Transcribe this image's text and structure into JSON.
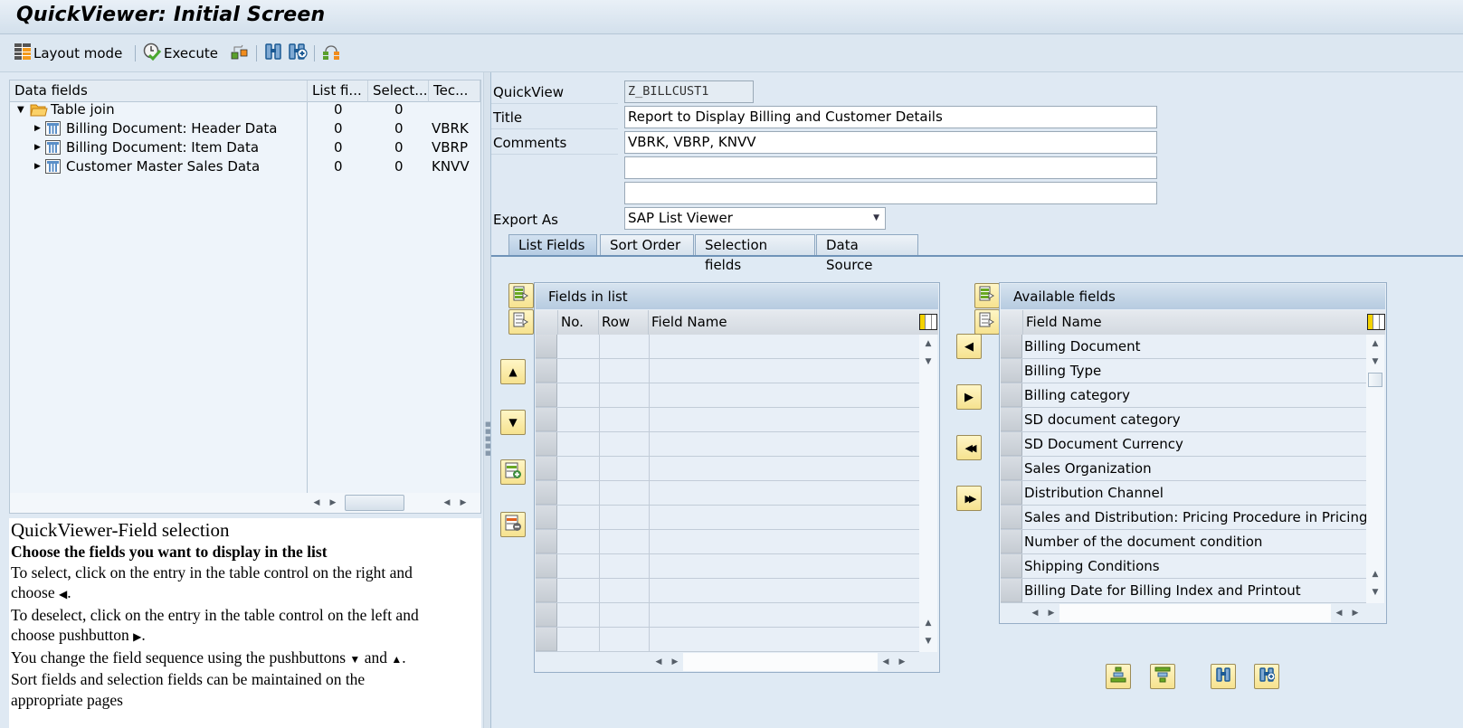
{
  "window": {
    "title": "QuickViewer: Initial Screen"
  },
  "toolbar": {
    "layout_mode": "Layout mode",
    "execute": "Execute",
    "icons": [
      "layout-grid-icon",
      "execute-clock-check-icon",
      "transport-icon",
      "find-icon",
      "find-next-icon",
      "hierarchy-icon"
    ]
  },
  "tree": {
    "headers": [
      "Data fields",
      "List fi...",
      "Select...",
      "Tec..."
    ],
    "rows": [
      {
        "label": "Table join",
        "list": "0",
        "select": "0",
        "tech": "",
        "level": 0,
        "expanded": true,
        "icon": "folder-icon"
      },
      {
        "label": "Billing Document: Header Data",
        "list": "0",
        "select": "0",
        "tech": "VBRK",
        "level": 1,
        "expanded": false,
        "icon": "table-icon"
      },
      {
        "label": "Billing Document: Item Data",
        "list": "0",
        "select": "0",
        "tech": "VBRP",
        "level": 1,
        "expanded": false,
        "icon": "table-icon"
      },
      {
        "label": "Customer Master Sales Data",
        "list": "0",
        "select": "0",
        "tech": "KNVV",
        "level": 1,
        "expanded": false,
        "icon": "table-icon"
      }
    ]
  },
  "help": {
    "title": "QuickViewer-Field selection",
    "subtitle": "Choose the fields you want to display in the list",
    "lines": [
      "To select, click on the entry in the table control on the right and",
      "choose",
      "To deselect, click on the entry in the table control on the left and",
      "choose pushbutton",
      "You change the field sequence using the pushbuttons",
      "and",
      "Sort fields and selection fields can be maintained on the",
      "appropriate pages"
    ]
  },
  "form": {
    "quickview_label": "QuickView",
    "quickview_value": "Z_BILLCUST1",
    "title_label": "Title",
    "title_value": "Report to Display Billing and Customer Details",
    "comments_label": "Comments",
    "comments_value": "VBRK, VBRP, KNVV",
    "comments_line2": "",
    "comments_line3": "",
    "export_label": "Export As",
    "export_value": "SAP List Viewer"
  },
  "tabs": [
    {
      "label": "List Fields",
      "active": true
    },
    {
      "label": "Sort Order",
      "active": false
    },
    {
      "label": "Selection fields",
      "active": false
    },
    {
      "label": "Data Source",
      "active": false
    }
  ],
  "fields_in_list": {
    "title": "Fields in list",
    "headers": [
      "No.",
      "Row",
      "Field Name"
    ],
    "rows": [
      "",
      "",
      "",
      "",
      "",
      "",
      "",
      "",
      "",
      "",
      "",
      "",
      ""
    ]
  },
  "available_fields": {
    "title": "Available fields",
    "header": "Field Name",
    "rows": [
      "Billing Document",
      "Billing Type",
      "Billing category",
      "SD document category",
      "SD Document Currency",
      "Sales Organization",
      "Distribution Channel",
      "Sales and Distribution: Pricing Procedure in Pricing",
      "Number of the document condition",
      "Shipping Conditions",
      "Billing Date for Billing Index and Printout"
    ]
  },
  "colors": {
    "background": "#dfe9f3",
    "button_yellow": "#f6e28f",
    "tab_active": "#b4cbe2",
    "accent_border": "#6f93b8"
  }
}
